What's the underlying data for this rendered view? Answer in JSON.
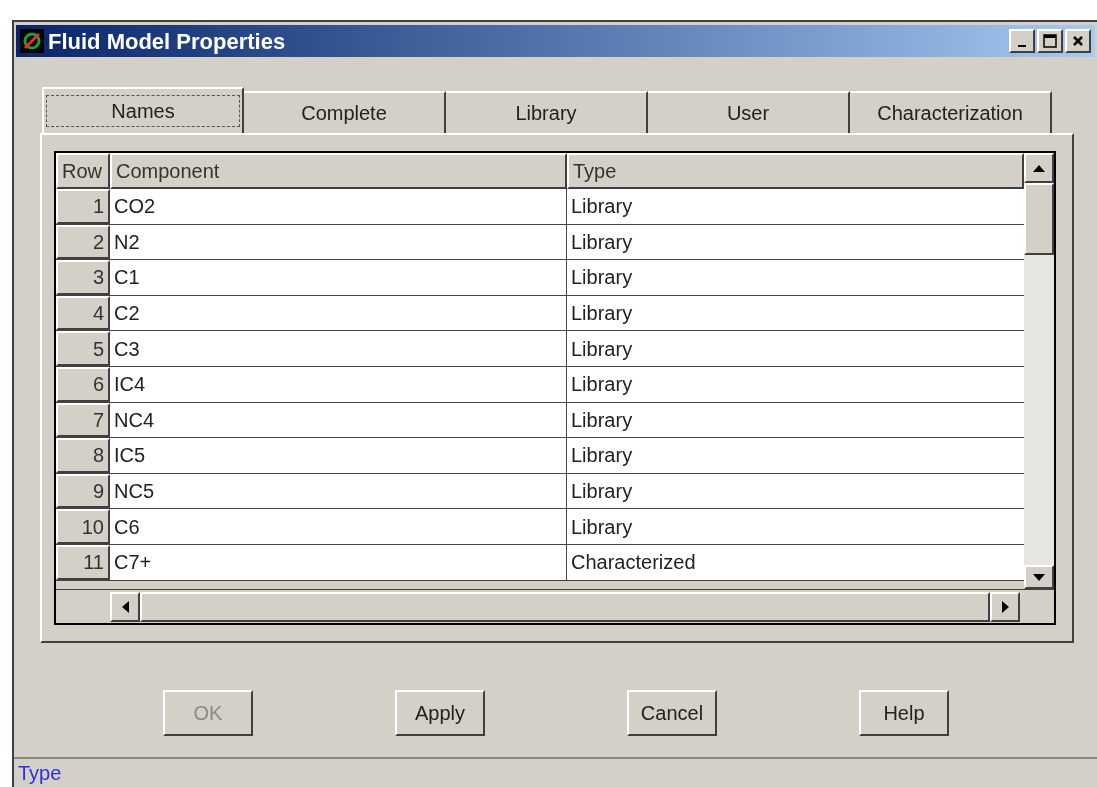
{
  "window": {
    "title": "Fluid Model Properties"
  },
  "tabs": [
    {
      "label": "Names",
      "selected": true
    },
    {
      "label": "Complete",
      "selected": false
    },
    {
      "label": "Library",
      "selected": false
    },
    {
      "label": "User",
      "selected": false
    },
    {
      "label": "Characterization",
      "selected": false
    }
  ],
  "table": {
    "columns": [
      "Row",
      "Component",
      "Type"
    ],
    "rows": [
      [
        "1",
        "CO2",
        "Library"
      ],
      [
        "2",
        "N2",
        "Library"
      ],
      [
        "3",
        "C1",
        "Library"
      ],
      [
        "4",
        "C2",
        "Library"
      ],
      [
        "5",
        "C3",
        "Library"
      ],
      [
        "6",
        "IC4",
        "Library"
      ],
      [
        "7",
        "NC4",
        "Library"
      ],
      [
        "8",
        "IC5",
        "Library"
      ],
      [
        "9",
        "NC5",
        "Library"
      ],
      [
        "10",
        "C6",
        "Library"
      ],
      [
        "11",
        "C7+",
        "Characterized"
      ]
    ]
  },
  "buttons": [
    {
      "label": "OK",
      "disabled": true
    },
    {
      "label": "Apply",
      "disabled": false
    },
    {
      "label": "Cancel",
      "disabled": false
    },
    {
      "label": "Help",
      "disabled": false
    }
  ],
  "status_bar": {
    "text": "Type"
  }
}
